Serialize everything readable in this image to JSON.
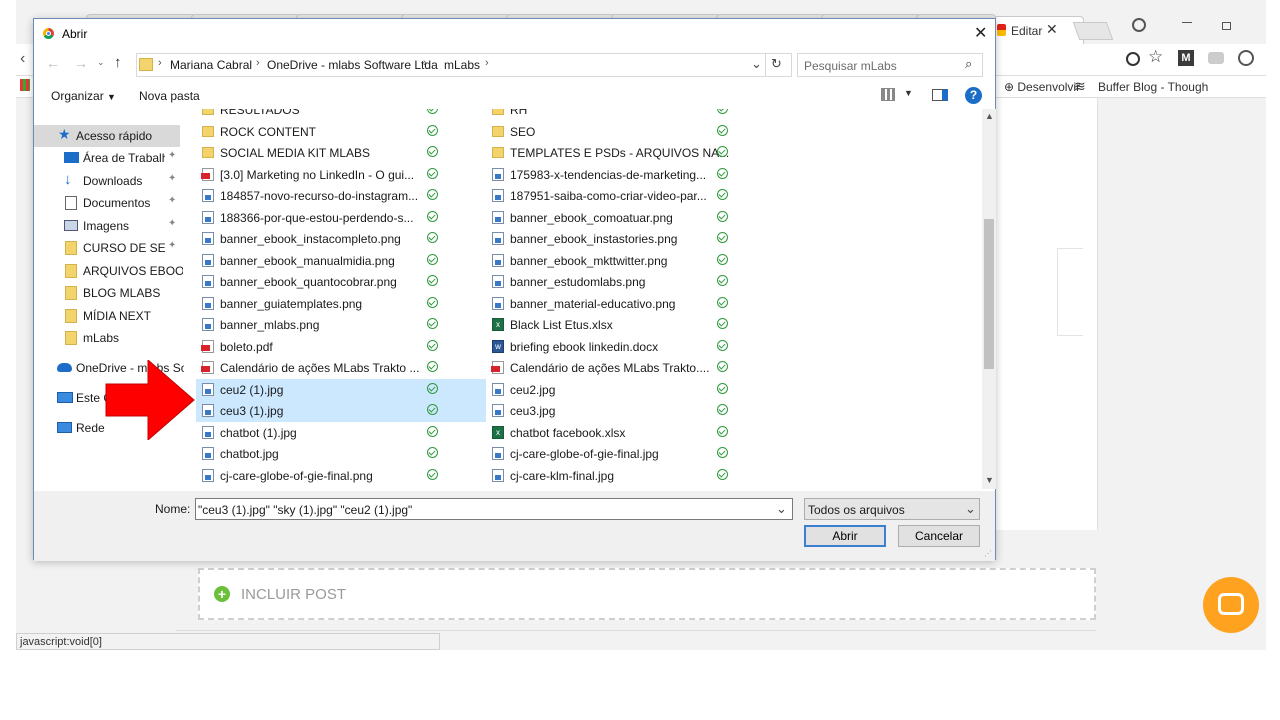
{
  "browser": {
    "active_tab_label": "Editar",
    "bookmarks": [
      "Desenvolvir",
      "Buffer Blog - Though"
    ],
    "status_text": "javascript:void[0]",
    "include_post_label": "INCLUIR POST"
  },
  "dialog": {
    "title": "Abrir",
    "breadcrumb": [
      "Mariana Cabral",
      "OneDrive - mlabs Software Ltda",
      "mLabs"
    ],
    "search_placeholder": "Pesquisar mLabs",
    "organize_label": "Organizar",
    "new_folder_label": "Nova pasta",
    "nav_items": [
      {
        "label": "Acesso rápido",
        "icon": "star-icon"
      },
      {
        "label": "Área de Trabalho",
        "icon": "desktop-icon"
      },
      {
        "label": "Downloads",
        "icon": "download-icon"
      },
      {
        "label": "Documentos",
        "icon": "document-icon"
      },
      {
        "label": "Imagens",
        "icon": "image-icon"
      },
      {
        "label": "CURSO DE SEO H",
        "icon": "folder-icon"
      },
      {
        "label": "ARQUIVOS EBOOKS",
        "icon": "folder-icon"
      },
      {
        "label": "BLOG MLABS",
        "icon": "folder-icon"
      },
      {
        "label": "MÍDIA NEXT",
        "icon": "folder-icon"
      },
      {
        "label": "mLabs",
        "icon": "folder-icon"
      },
      {
        "label": "OneDrive - mlabs Sof",
        "icon": "cloud-icon"
      },
      {
        "label": "Este C",
        "icon": "computer-icon"
      },
      {
        "label": "Rede",
        "icon": "network-icon"
      }
    ],
    "files_left": [
      {
        "name": "RESULTADOS",
        "type": "folder"
      },
      {
        "name": "ROCK CONTENT",
        "type": "folder"
      },
      {
        "name": "SOCIAL MEDIA KIT MLABS",
        "type": "folder"
      },
      {
        "name": "[3.0] Marketing no LinkedIn - O gui...",
        "type": "pdf"
      },
      {
        "name": "184857-novo-recurso-do-instagram...",
        "type": "image"
      },
      {
        "name": "188366-por-que-estou-perdendo-s...",
        "type": "image"
      },
      {
        "name": "banner_ebook_instacompleto.png",
        "type": "image"
      },
      {
        "name": "banner_ebook_manualmidia.png",
        "type": "image"
      },
      {
        "name": "banner_ebook_quantocobrar.png",
        "type": "image"
      },
      {
        "name": "banner_guiatemplates.png",
        "type": "image"
      },
      {
        "name": "banner_mlabs.png",
        "type": "image"
      },
      {
        "name": "boleto.pdf",
        "type": "pdf"
      },
      {
        "name": "Calendário de ações MLabs Trakto ...",
        "type": "pdf"
      },
      {
        "name": "ceu2 (1).jpg",
        "type": "image",
        "selected": true
      },
      {
        "name": "ceu3 (1).jpg",
        "type": "image",
        "selected": true
      },
      {
        "name": "chatbot (1).jpg",
        "type": "image"
      },
      {
        "name": "chatbot.jpg",
        "type": "image"
      },
      {
        "name": "cj-care-globe-of-gie-final.png",
        "type": "image"
      }
    ],
    "files_right": [
      {
        "name": "RH",
        "type": "folder"
      },
      {
        "name": "SEO",
        "type": "folder"
      },
      {
        "name": "TEMPLATES E PSDs - ARQUIVOS NA...",
        "type": "folder"
      },
      {
        "name": "175983-x-tendencias-de-marketing...",
        "type": "image"
      },
      {
        "name": "187951-saiba-como-criar-video-par...",
        "type": "image"
      },
      {
        "name": "banner_ebook_comoatuar.png",
        "type": "image"
      },
      {
        "name": "banner_ebook_instastories.png",
        "type": "image"
      },
      {
        "name": "banner_ebook_mkttwitter.png",
        "type": "image"
      },
      {
        "name": "banner_estudomlabs.png",
        "type": "image"
      },
      {
        "name": "banner_material-educativo.png",
        "type": "image"
      },
      {
        "name": "Black List Etus.xlsx",
        "type": "excel"
      },
      {
        "name": "briefing ebook linkedin.docx",
        "type": "word"
      },
      {
        "name": "Calendário de ações MLabs  Trakto....",
        "type": "pdf"
      },
      {
        "name": "ceu2.jpg",
        "type": "image"
      },
      {
        "name": "ceu3.jpg",
        "type": "image"
      },
      {
        "name": "chatbot facebook.xlsx",
        "type": "excel"
      },
      {
        "name": "cj-care-globe-of-gie-final.jpg",
        "type": "image"
      },
      {
        "name": "cj-care-klm-final.jpg",
        "type": "image"
      }
    ],
    "filename_label": "Nome:",
    "filename_value": "\"ceu3 (1).jpg\" \"sky (1).jpg\" \"ceu2 (1).jpg\"",
    "filetype_value": "Todos os arquivos",
    "open_button": "Abrir",
    "cancel_button": "Cancelar"
  },
  "colors": {
    "selection": "#cce8ff",
    "sync_green": "#2e9a3c",
    "arrow_red": "#ff0000",
    "chat_orange": "#ffa21f"
  }
}
